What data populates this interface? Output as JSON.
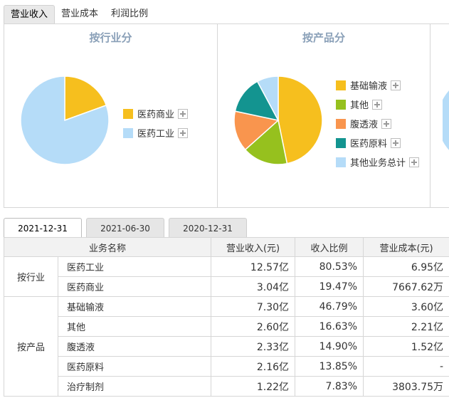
{
  "top_tabs": [
    "营业收入",
    "营业成本",
    "利润比例"
  ],
  "industry_panel": {
    "title": "按行业分",
    "legend": [
      {
        "label": "医药商业",
        "color": "#f6bf1e"
      },
      {
        "label": "医药工业",
        "color": "#b5dcf8"
      }
    ]
  },
  "product_panel": {
    "title": "按产品分",
    "legend": [
      {
        "label": "基础输液",
        "color": "#f6bf1e"
      },
      {
        "label": "其他",
        "color": "#96c11e"
      },
      {
        "label": "腹透液",
        "color": "#f9954e"
      },
      {
        "label": "医药原料",
        "color": "#139490"
      },
      {
        "label": "其他业务总计",
        "color": "#b5dcf8"
      }
    ]
  },
  "chart_data": [
    {
      "type": "pie",
      "title": "按行业分",
      "slices": [
        {
          "name": "医药商业",
          "value": 19.47,
          "color": "#f6bf1e"
        },
        {
          "name": "医药工业",
          "value": 80.53,
          "color": "#b5dcf8"
        }
      ]
    },
    {
      "type": "pie",
      "title": "按产品分",
      "slices": [
        {
          "name": "基础输液",
          "value": 46.79,
          "color": "#f6bf1e"
        },
        {
          "name": "其他",
          "value": 16.63,
          "color": "#96c11e"
        },
        {
          "name": "腹透液",
          "value": 14.9,
          "color": "#f9954e"
        },
        {
          "name": "医药原料",
          "value": 13.85,
          "color": "#139490"
        },
        {
          "name": "其他业务总计",
          "value": 7.83,
          "color": "#b5dcf8"
        }
      ]
    }
  ],
  "date_tabs": [
    "2021-12-31",
    "2021-06-30",
    "2020-12-31"
  ],
  "table": {
    "headers": [
      "业务名称",
      "营业收入(元)",
      "收入比例",
      "营业成本(元)"
    ],
    "groups": [
      {
        "label": "按行业",
        "rows": [
          {
            "name": "医药工业",
            "revenue": "12.57亿",
            "ratio": "80.53%",
            "cost": "6.95亿"
          },
          {
            "name": "医药商业",
            "revenue": "3.04亿",
            "ratio": "19.47%",
            "cost": "7667.62万"
          }
        ]
      },
      {
        "label": "按产品",
        "rows": [
          {
            "name": "基础输液",
            "revenue": "7.30亿",
            "ratio": "46.79%",
            "cost": "3.60亿"
          },
          {
            "name": "其他",
            "revenue": "2.60亿",
            "ratio": "16.63%",
            "cost": "2.21亿"
          },
          {
            "name": "腹透液",
            "revenue": "2.33亿",
            "ratio": "14.90%",
            "cost": "1.52亿"
          },
          {
            "name": "医药原料",
            "revenue": "2.16亿",
            "ratio": "13.85%",
            "cost": "-"
          },
          {
            "name": "治疗制剂",
            "revenue": "1.22亿",
            "ratio": "7.83%",
            "cost": "3803.75万"
          }
        ]
      }
    ]
  }
}
